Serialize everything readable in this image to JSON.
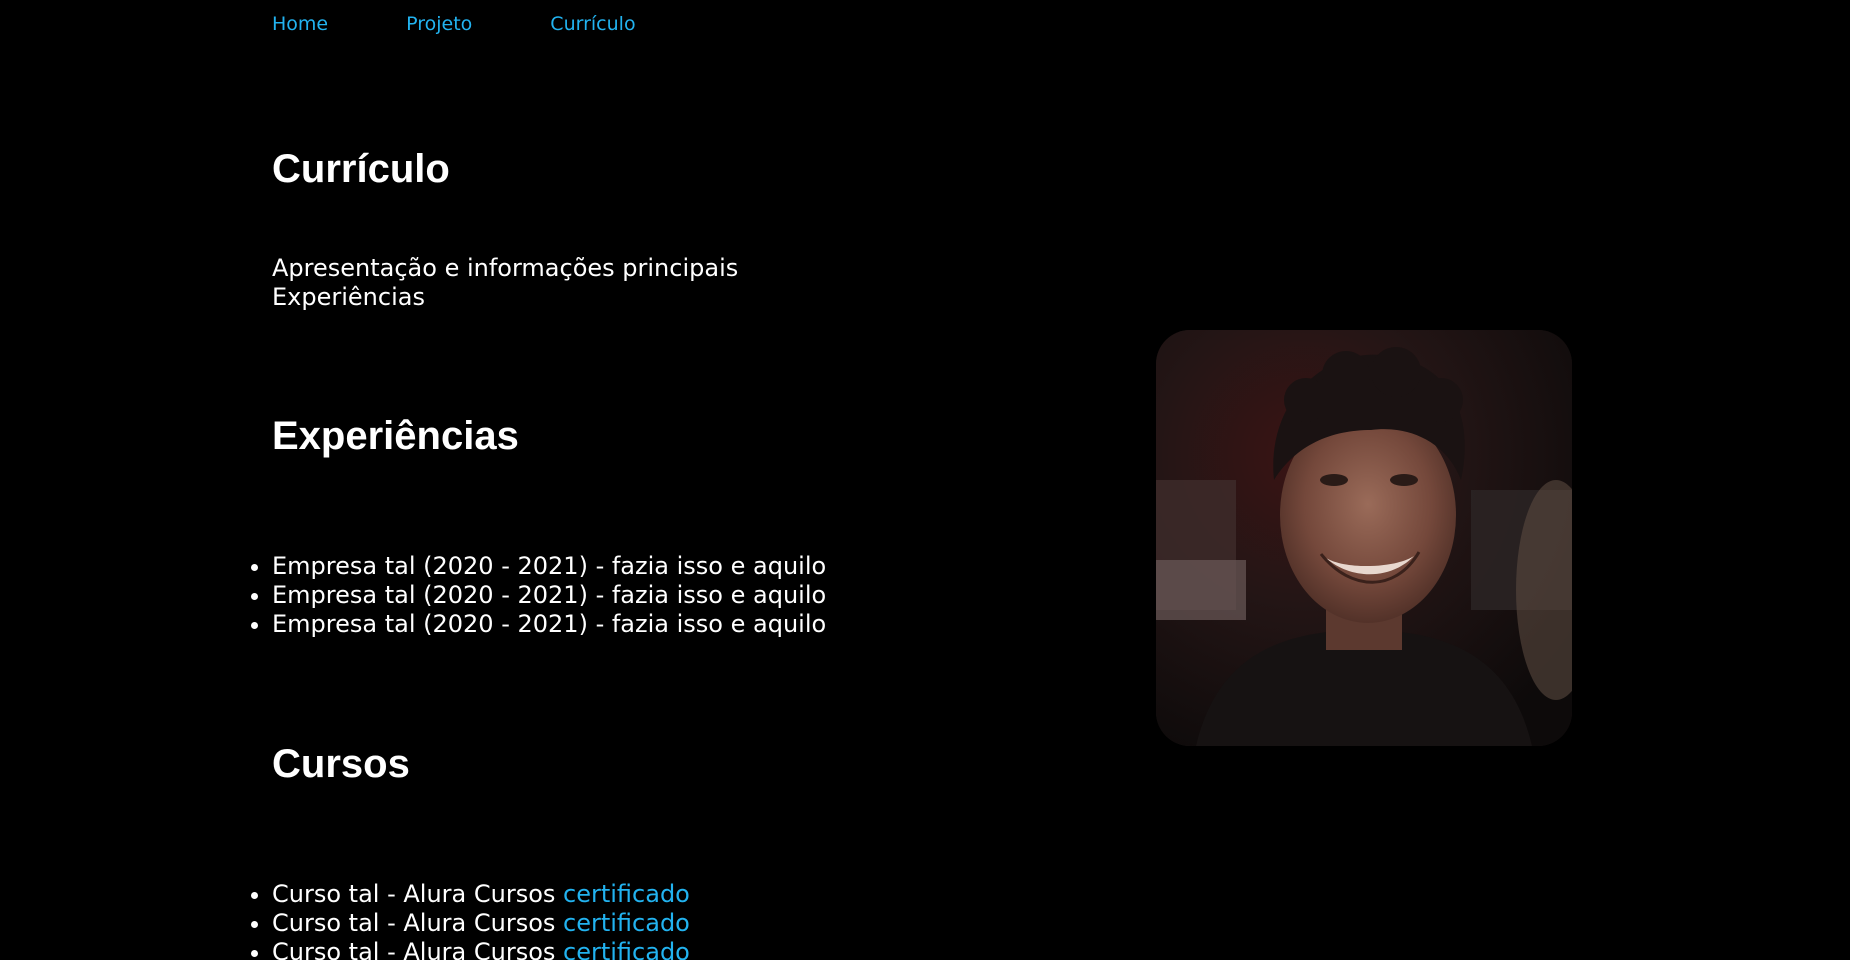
{
  "nav": {
    "items": [
      {
        "label": "Home"
      },
      {
        "label": "Projeto"
      },
      {
        "label": "Currículo"
      }
    ]
  },
  "page": {
    "title": "Currículo",
    "intro_lines": [
      "Apresentação e informações principais",
      "Experiências"
    ]
  },
  "experiencias": {
    "heading": "Experiências",
    "items": [
      "Empresa tal (2020 - 2021) - fazia isso e aquilo",
      "Empresa tal (2020 - 2021) - fazia isso e aquilo",
      "Empresa tal (2020 - 2021) - fazia isso e aquilo"
    ]
  },
  "cursos": {
    "heading": "Cursos",
    "items": [
      {
        "text": "Curso tal - Alura Cursos ",
        "link": "certificado"
      },
      {
        "text": "Curso tal - Alura Cursos ",
        "link": "certificado"
      },
      {
        "text": "Curso tal - Alura Cursos ",
        "link": "certificado"
      }
    ]
  },
  "colors": {
    "background": "#000000",
    "text": "#ffffff",
    "link": "#22b3f0"
  }
}
